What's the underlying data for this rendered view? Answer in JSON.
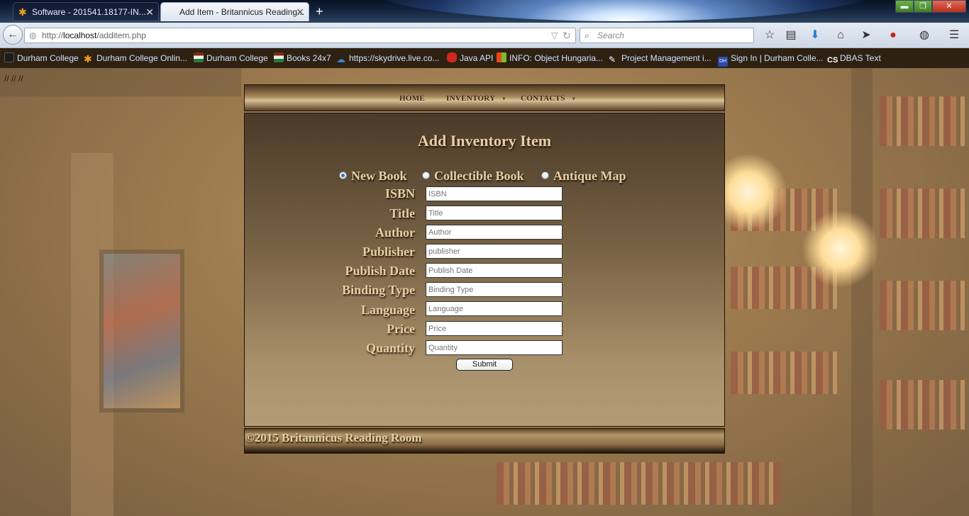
{
  "browser": {
    "tabs": [
      {
        "label": "Software - 201541.18177-IN..."
      },
      {
        "label": "Add Item - Britannicus Reading..."
      }
    ],
    "new_tab": "+",
    "url_prefix": "http://",
    "url_host": "localhost",
    "url_path": "/additem.php",
    "search_placeholder": "Search",
    "bookmarks": [
      {
        "label": "Durham College",
        "icon": "blank-page-icon"
      },
      {
        "label": "Durham College Onlin...",
        "icon": "asterisk-logo-icon"
      },
      {
        "label": "Durham College",
        "icon": "flag-icon"
      },
      {
        "label": "Books 24x7",
        "icon": "flag-icon"
      },
      {
        "label": "https://skydrive.live.co...",
        "icon": "cloud-icon"
      },
      {
        "label": "Java API",
        "icon": "oracle-icon"
      },
      {
        "label": "INFO: Object Hungaria...",
        "icon": "windows-icon"
      },
      {
        "label": "Project Management i...",
        "icon": "pen-icon"
      },
      {
        "label": "Sign In | Durham Colle...",
        "icon": "dc-icon"
      },
      {
        "label": "DBAS Text",
        "icon": "cs-icon"
      }
    ],
    "bookmark_cs_glyph": "CS",
    "bookmark_dc_glyph": "DH"
  },
  "page": {
    "breadcrumb": "// // //",
    "menu": [
      {
        "label": "HOME"
      },
      {
        "label": "INVENTORY",
        "caret": "▼"
      },
      {
        "label": "CONTACTS",
        "caret": "▼"
      }
    ],
    "heading": "Add Inventory Item",
    "item_types": [
      {
        "label": "New Book",
        "selected": true
      },
      {
        "label": "Collectible Book",
        "selected": false
      },
      {
        "label": "Antique Map",
        "selected": false
      }
    ],
    "fields": [
      {
        "label": "ISBN",
        "placeholder": "ISBN"
      },
      {
        "label": "Title",
        "placeholder": "Title"
      },
      {
        "label": "Author",
        "placeholder": "Author"
      },
      {
        "label": "Publisher",
        "placeholder": "publisher"
      },
      {
        "label": "Publish Date",
        "placeholder": "Publish Date"
      },
      {
        "label": "Binding Type",
        "placeholder": "Binding Type"
      },
      {
        "label": "Language",
        "placeholder": "Language"
      },
      {
        "label": "Price",
        "placeholder": "Price"
      },
      {
        "label": "Quantity",
        "placeholder": "Quantity"
      }
    ],
    "submit_label": "Submit",
    "footer": "©2015 Britannicus Reading Room"
  },
  "colors": {
    "text_gold": "#e6cfa2",
    "panel_top": "#4a3a28",
    "panel_bottom": "#b29c76"
  }
}
